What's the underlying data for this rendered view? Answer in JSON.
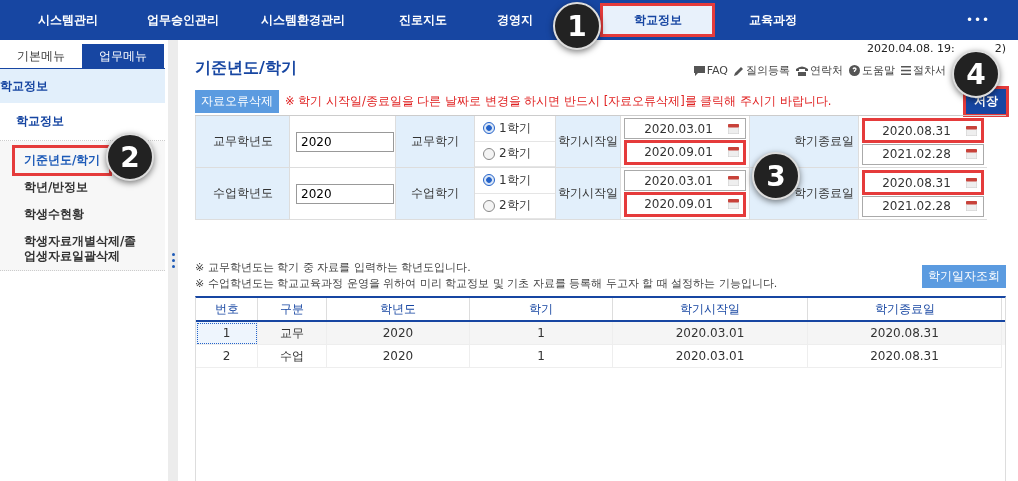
{
  "nav": [
    {
      "label": "시스템관리",
      "selected": false,
      "highlighted": false
    },
    {
      "label": "업무승인관리",
      "selected": false,
      "highlighted": false
    },
    {
      "label": "시스템환경관리",
      "selected": false,
      "highlighted": false
    },
    {
      "label": "진로지도",
      "selected": false,
      "highlighted": false
    },
    {
      "label": "경영지",
      "selected": false,
      "highlighted": false
    },
    {
      "label": "학교정보",
      "selected": true,
      "highlighted": true
    },
    {
      "label": "교육과정",
      "selected": false,
      "highlighted": false
    }
  ],
  "nav_more": "•••",
  "sidebar": {
    "tabs": [
      {
        "label": "기본메뉴",
        "selected": false
      },
      {
        "label": "업무메뉴",
        "selected": true
      }
    ],
    "section": "학교정보",
    "group": "학교정보",
    "items": [
      {
        "label": "기준년도/학기",
        "selected": true,
        "highlighted": true
      },
      {
        "label": "학년/반정보",
        "selected": false,
        "highlighted": false
      },
      {
        "label": "학생수현황",
        "selected": false,
        "highlighted": false
      },
      {
        "label": "학생자료개별삭제/졸업생자료일괄삭제",
        "selected": false,
        "highlighted": false
      }
    ]
  },
  "page": {
    "title": "기준년도/학기",
    "datetime": "2020.04.08. 19:",
    "datetime_tail": "2)",
    "links": [
      {
        "kind": "faq",
        "label": "FAQ"
      },
      {
        "kind": "pencil",
        "label": "질의등록"
      },
      {
        "kind": "phone",
        "label": "연락처"
      },
      {
        "kind": "help",
        "label": "도움말"
      },
      {
        "kind": "list",
        "label": "절차서"
      }
    ],
    "delete_button": "자료오류삭제",
    "warning": "※ 학기 시작일/종료일을 다른 날짜로 변경을 하시면 반드시 [자료오류삭제]를 클릭해 주시기 바랍니다.",
    "save_button": {
      "label": "저장",
      "highlighted": true
    }
  },
  "form": [
    {
      "label": "교무학년도",
      "year": "2020",
      "term_label": "교무학기",
      "terms": [
        {
          "label": "1학기",
          "selected": true
        },
        {
          "label": "2학기",
          "selected": false
        }
      ],
      "start_label": "학기시작일",
      "starts": [
        {
          "value": "2020.03.01",
          "highlighted": false
        },
        {
          "value": "2020.09.01",
          "highlighted": true
        }
      ],
      "end_label": "학기종료일",
      "ends": [
        {
          "value": "2020.08.31",
          "highlighted": true
        },
        {
          "value": "2021.02.28",
          "highlighted": false
        }
      ]
    },
    {
      "label": "수업학년도",
      "year": "2020",
      "term_label": "수업학기",
      "terms": [
        {
          "label": "1학기",
          "selected": true
        },
        {
          "label": "2학기",
          "selected": false
        }
      ],
      "start_label": "학기시작일",
      "starts": [
        {
          "value": "2020.03.01",
          "highlighted": false
        },
        {
          "value": "2020.09.01",
          "highlighted": true
        }
      ],
      "end_label": "학기종료일",
      "ends": [
        {
          "value": "2020.08.31",
          "highlighted": true
        },
        {
          "value": "2021.02.28",
          "highlighted": false
        }
      ]
    }
  ],
  "notes": [
    "※ 교무학년도는 학기 중 자료를 입력하는 학년도입니다.",
    "※ 수업학년도는 학교교육과정 운영을 위하여 미리 학교정보 및 기초 자료를 등록해 두고자 할 때 설정하는 기능입니다."
  ],
  "lookup_button": "학기일자조회",
  "table": {
    "columns": [
      "번호",
      "구분",
      "학년도",
      "학기",
      "학기시작일",
      "학기종료일"
    ],
    "rows": [
      {
        "cells": [
          "1",
          "교무",
          "2020",
          "1",
          "2020.03.01",
          "2020.08.31"
        ],
        "selected": true
      },
      {
        "cells": [
          "2",
          "수업",
          "2020",
          "1",
          "2020.03.01",
          "2020.08.31"
        ],
        "selected": false
      }
    ]
  },
  "callouts": [
    "1",
    "2",
    "3",
    "4"
  ]
}
